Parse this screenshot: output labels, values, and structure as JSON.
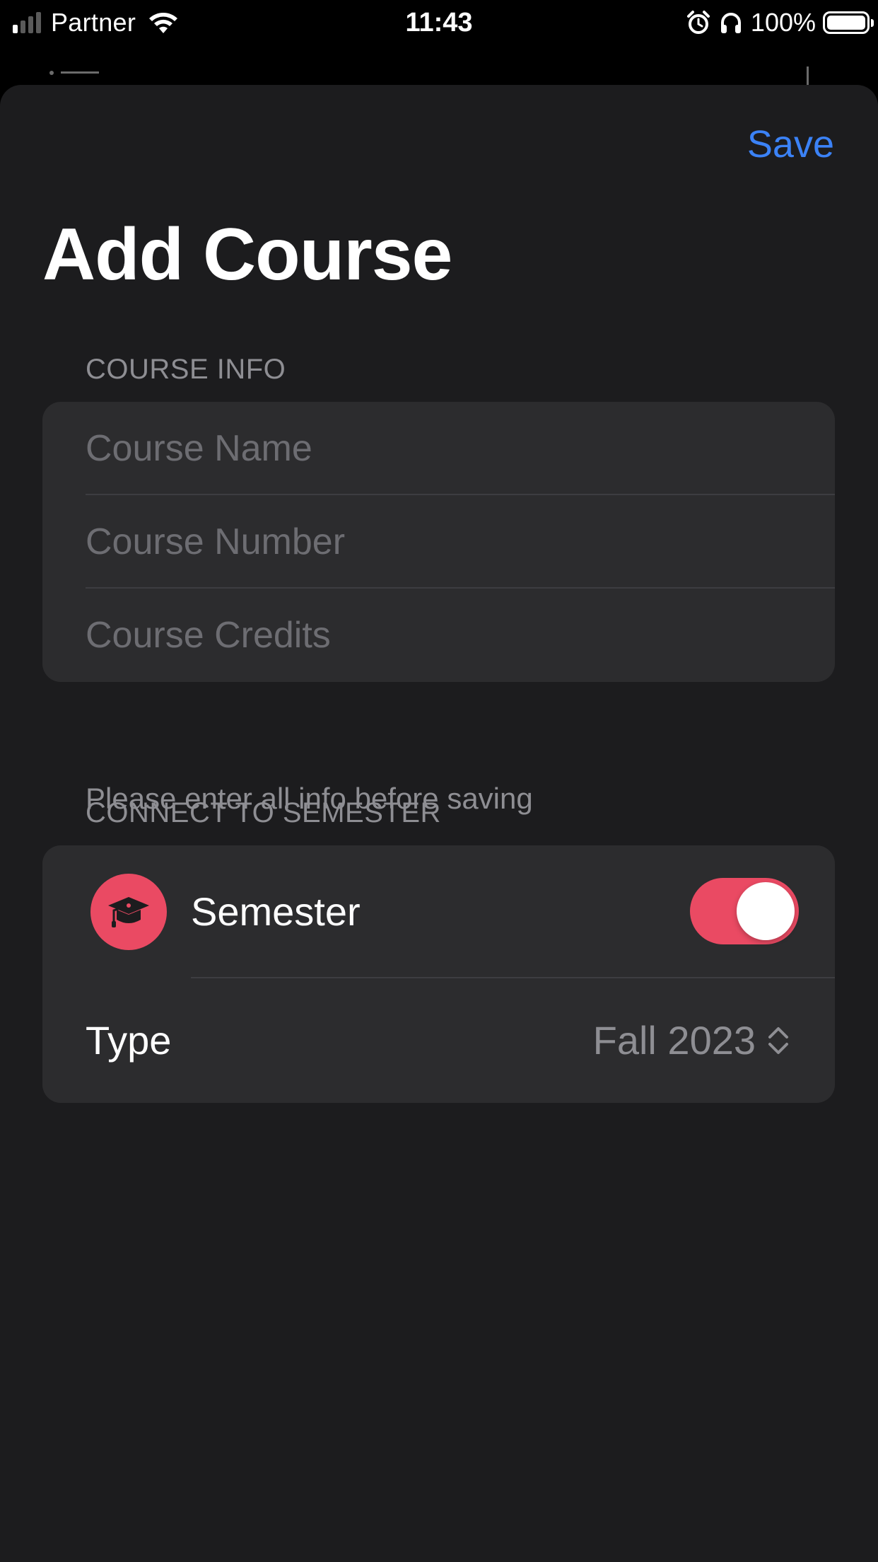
{
  "status_bar": {
    "carrier": "Partner",
    "time": "11:43",
    "battery_percent": "100%",
    "signal_bars_active": 1,
    "signal_bars_total": 4
  },
  "header": {
    "save_label": "Save",
    "title": "Add Course"
  },
  "course_info": {
    "section_title": "COURSE INFO",
    "fields": [
      {
        "placeholder": "Course Name",
        "value": ""
      },
      {
        "placeholder": "Course Number",
        "value": ""
      },
      {
        "placeholder": "Course Credits",
        "value": ""
      }
    ],
    "footer": "Please enter all info before saving"
  },
  "semester": {
    "section_title": "CONNECT TO SEMESTER",
    "toggle_label": "Semester",
    "toggle_on": true,
    "icon": "graduation-cap-icon",
    "type_label": "Type",
    "type_value": "Fall 2023"
  },
  "colors": {
    "accent_blue": "#3b82f6",
    "accent_red": "#ea4a63",
    "background": "#1c1c1e",
    "grouped_cell": "#2c2c2e",
    "secondary_text": "#8e8e93"
  }
}
